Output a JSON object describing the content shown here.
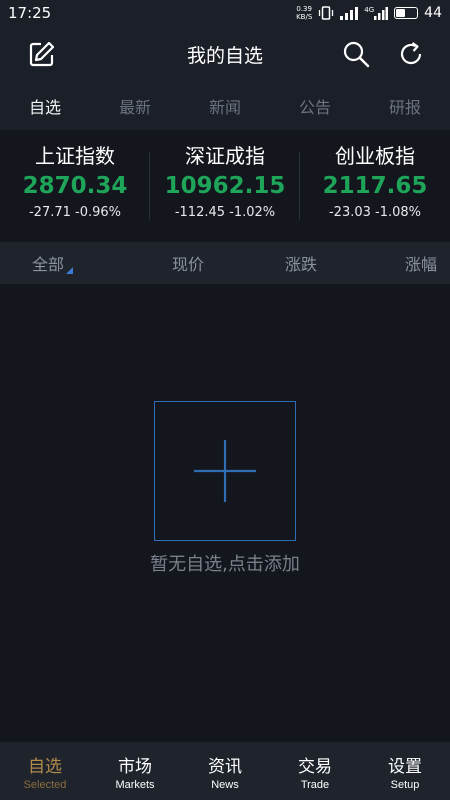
{
  "status_bar": {
    "time": "17:25",
    "net_speed_value": "0.39",
    "net_speed_unit": "KB/S",
    "network_type": "4G",
    "battery": "44"
  },
  "header": {
    "title": "我的自选",
    "icons": [
      "edit-icon",
      "search-icon",
      "refresh-icon"
    ]
  },
  "tabs": [
    {
      "label": "自选",
      "active": true
    },
    {
      "label": "最新",
      "active": false
    },
    {
      "label": "新闻",
      "active": false
    },
    {
      "label": "公告",
      "active": false
    },
    {
      "label": "研报",
      "active": false
    }
  ],
  "indices": [
    {
      "name": "上证指数",
      "value": "2870.34",
      "change": "-27.71 -0.96%"
    },
    {
      "name": "深证成指",
      "value": "10962.15",
      "change": "-112.45 -1.02%"
    },
    {
      "name": "创业板指",
      "value": "2117.65",
      "change": "-23.03 -1.08%"
    }
  ],
  "columns": {
    "all": "全部",
    "price": "现价",
    "change": "涨跌",
    "change_pct": "涨幅"
  },
  "empty_state": {
    "message": "暂无自选,点击添加"
  },
  "bottom_nav": [
    {
      "zh": "自选",
      "en": "Selected",
      "active": true
    },
    {
      "zh": "市场",
      "en": "Markets",
      "active": false
    },
    {
      "zh": "资讯",
      "en": "News",
      "active": false
    },
    {
      "zh": "交易",
      "en": "Trade",
      "active": false
    },
    {
      "zh": "设置",
      "en": "Setup",
      "active": false
    }
  ],
  "colors": {
    "up_down_green": "#1ea55a",
    "accent_gold": "#b28a4a",
    "accent_blue": "#2f6db5"
  }
}
